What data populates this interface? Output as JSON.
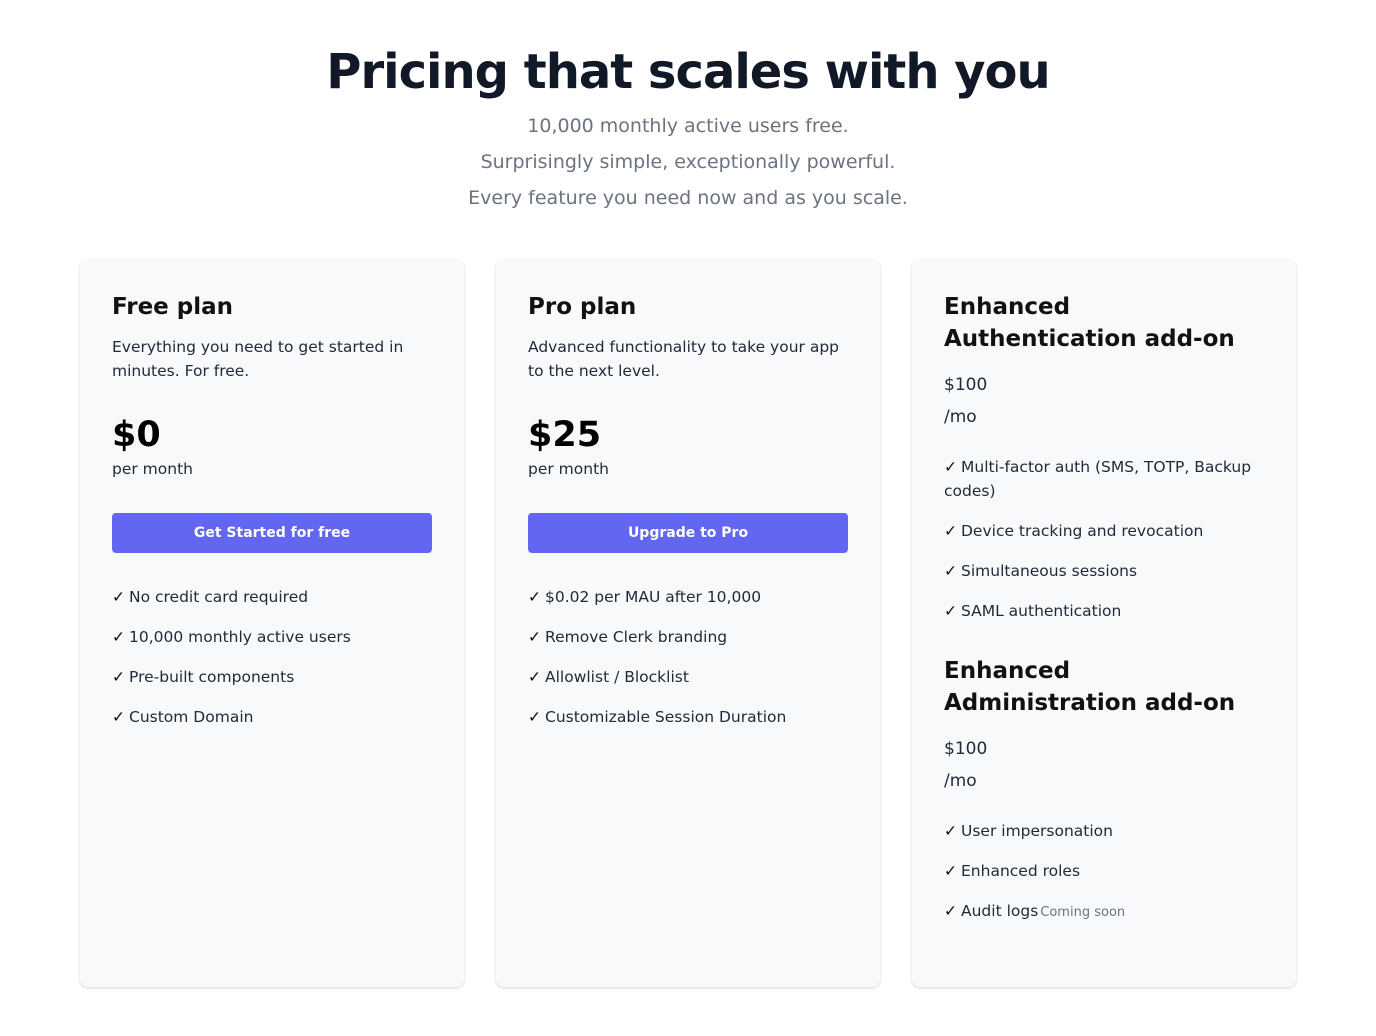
{
  "header": {
    "title": "Pricing that scales with you",
    "subtitle_lines": [
      "10,000 monthly active users free.",
      "Surprisingly simple, exceptionally powerful.",
      "Every feature you need now and as you scale."
    ]
  },
  "plans": [
    {
      "name": "Free plan",
      "description": "Everything you need to get started in minutes. For free.",
      "price": "$0",
      "period": "per month",
      "cta_label": "Get Started for free",
      "features": [
        "No credit card required",
        "10,000 monthly active users",
        "Pre-built components",
        "Custom Domain"
      ]
    },
    {
      "name": "Pro plan",
      "description": "Advanced functionality to take your app to the next level.",
      "price": "$25",
      "period": "per month",
      "cta_label": "Upgrade to Pro",
      "features": [
        "$0.02 per MAU after 10,000",
        "Remove Clerk branding",
        "Allowlist / Blocklist",
        "Customizable Session Duration"
      ]
    }
  ],
  "addons": [
    {
      "name": "Enhanced Authentication add-on",
      "price": "$100",
      "period": "/mo",
      "features": [
        "Multi-factor auth (SMS, TOTP, Backup codes)",
        "Device tracking and revocation",
        "Simultaneous sessions",
        "SAML authentication"
      ]
    },
    {
      "name": "Enhanced Administration add-on",
      "price": "$100",
      "period": "/mo",
      "features": [
        "User impersonation",
        "Enhanced roles",
        "Audit logs"
      ],
      "coming_soon_label": "Coming soon"
    }
  ],
  "check_glyph": "✓",
  "colors": {
    "accent": "#6366f1",
    "title": "#111827",
    "subtitle": "#6b7280",
    "card_bg": "#f8f9fa"
  }
}
